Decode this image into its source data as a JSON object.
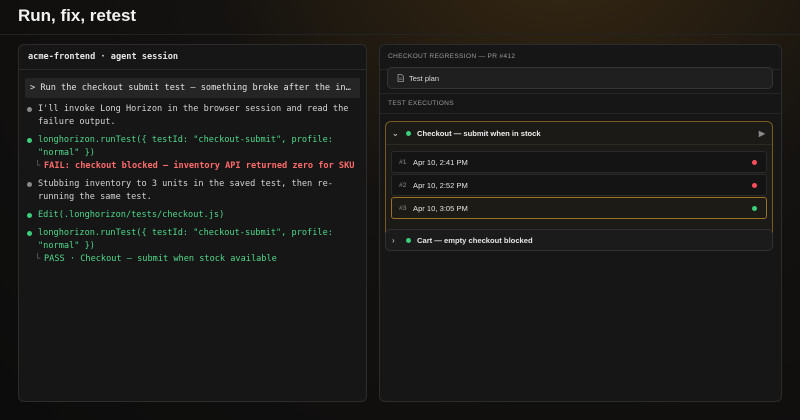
{
  "page": {
    "title": "Run, fix, retest"
  },
  "terminal": {
    "header": "acme-frontend · agent session",
    "prompt": "> Run the checkout submit test — something broke after the inventory cha…",
    "lines": [
      {
        "kind": "grey",
        "text": "I'll invoke Long Horizon in the browser session and read the failure output."
      },
      {
        "kind": "green",
        "text": "longhorizon.runTest({ testId: \"checkout-submit\", profile: \"normal\" })"
      },
      {
        "kind": "fail",
        "text": "FAIL: checkout blocked — inventory API returned zero for SKU"
      },
      {
        "kind": "grey",
        "text": "Stubbing inventory to 3 units in the saved test, then re-running the same test."
      },
      {
        "kind": "green",
        "text": "Edit(.longhorizon/tests/checkout.js)"
      },
      {
        "kind": "green",
        "text": "longhorizon.runTest({ testId: \"checkout-submit\", profile: \"normal\" })"
      },
      {
        "kind": "pass",
        "text": "PASS · Checkout — submit when stock available"
      }
    ]
  },
  "regression": {
    "header": "CHECKOUT REGRESSION — PR #412",
    "plan_label": "Test plan",
    "executions_label": "TEST EXECUTIONS",
    "groups": [
      {
        "label": "Checkout — submit when in stock",
        "status_color": "#3ccf7a",
        "expanded": true,
        "runs": [
          {
            "num": "#1",
            "time": "Apr 10, 2:41 PM",
            "status_color": "#ff4d5e",
            "selected": false
          },
          {
            "num": "#2",
            "time": "Apr 10, 2:52 PM",
            "status_color": "#ff4d5e",
            "selected": false
          },
          {
            "num": "#3",
            "time": "Apr 10, 3:05 PM",
            "status_color": "#3ccf7a",
            "selected": true
          }
        ]
      },
      {
        "label": "Cart — empty checkout blocked",
        "status_color": "#3ccf7a",
        "expanded": false
      }
    ]
  },
  "colors": {
    "accent": "#9b7126",
    "pass": "#3ccf7a",
    "fail": "#ff4d5e"
  }
}
